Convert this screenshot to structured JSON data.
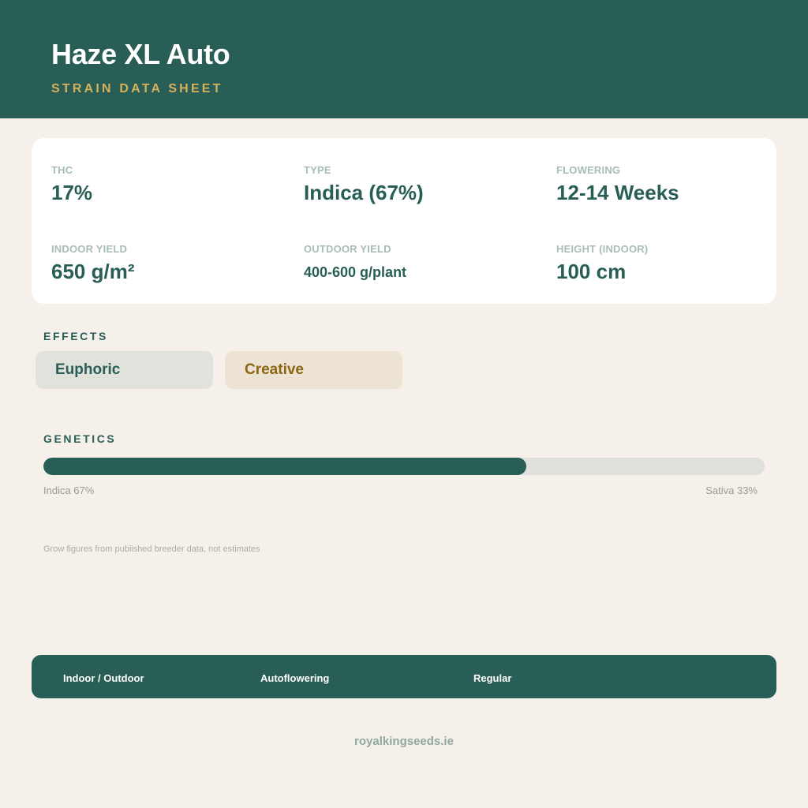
{
  "header": {
    "title": "Haze XL Auto",
    "subtitle": "STRAIN DATA SHEET"
  },
  "stats": {
    "thc": {
      "label": "THC",
      "value": "17%"
    },
    "type": {
      "label": "TYPE",
      "value": "Indica (67%)"
    },
    "flowering": {
      "label": "FLOWERING",
      "value": "12-14 Weeks"
    },
    "indoor_yield": {
      "label": "INDOOR YIELD",
      "value": "650 g/m²"
    },
    "outdoor_yield": {
      "label": "OUTDOOR YIELD",
      "value": "400-600 g/plant"
    },
    "height": {
      "label": "HEIGHT (INDOOR)",
      "value": "100 cm"
    }
  },
  "effects": {
    "label": "EFFECTS",
    "items": [
      "Euphoric",
      "Creative"
    ]
  },
  "genetics": {
    "label": "GENETICS",
    "indica_percent": 67,
    "indica_label": "Indica 67%",
    "sativa_label": "Sativa 33%"
  },
  "note": "Grow figures from published breeder data, not estimates",
  "footer": {
    "tags": [
      "Indoor / Outdoor",
      "Autoflowering",
      "Regular"
    ]
  },
  "site": "royalkingseeds.ie",
  "colors": {
    "brand": "#285e55",
    "accent": "#d4b25c",
    "background": "#f5f0ea"
  }
}
